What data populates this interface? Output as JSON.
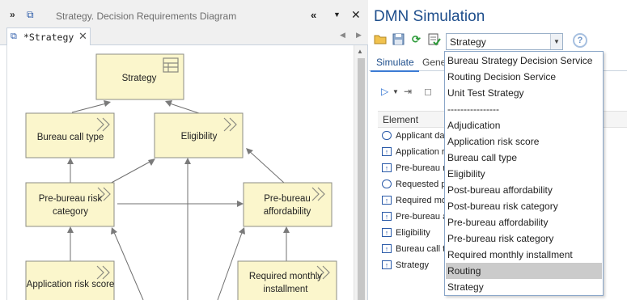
{
  "left_pane": {
    "title": "Strategy.  Decision Requirements Diagram",
    "tab_label": "*Strategy",
    "tab_close": "✕",
    "collapse_glyph": "«",
    "menu_glyph": "▼",
    "close_glyph": "✕"
  },
  "diagram": {
    "nodes": {
      "strategy": "Strategy",
      "bureau_call_type": "Bureau call type",
      "eligibility": "Eligibility",
      "pre_bureau_risk_line1": "Pre-bureau risk",
      "pre_bureau_risk_line2": "category",
      "pre_bureau_afford_line1": "Pre-bureau",
      "pre_bureau_afford_line2": "affordability",
      "application_risk_score": "Application risk score",
      "required_monthly_line1": "Required monthly",
      "required_monthly_line2": "installment"
    }
  },
  "right_pane": {
    "title": "DMN Simulation",
    "model_select_value": "Strategy",
    "help_glyph": "?",
    "tabs": {
      "simulate": "Simulate",
      "general": "Gene"
    },
    "element_header": "Element",
    "elements": [
      {
        "label": "Applicant da",
        "kind": "input"
      },
      {
        "label": "Application ri",
        "kind": "decision"
      },
      {
        "label": "Pre-bureau r",
        "kind": "decision"
      },
      {
        "label": "Requested p",
        "kind": "input"
      },
      {
        "label": "Required mon",
        "kind": "decision"
      },
      {
        "label": "Pre-bureau a",
        "kind": "decision"
      },
      {
        "label": "Eligibility",
        "kind": "decision"
      },
      {
        "label": "Bureau call t",
        "kind": "decision"
      },
      {
        "label": "Strategy",
        "kind": "decision"
      }
    ]
  },
  "dropdown": {
    "items": [
      "Bureau Strategy Decision Service",
      "Routing Decision Service",
      "Unit Test Strategy",
      "----------------",
      "Adjudication",
      "Application risk score",
      "Bureau call type",
      "Eligibility",
      "Post-bureau affordability",
      "Post-bureau risk category",
      "Pre-bureau affordability",
      "Pre-bureau risk category",
      "Required monthly installment",
      "Routing",
      "Strategy"
    ],
    "selected": "Routing"
  }
}
